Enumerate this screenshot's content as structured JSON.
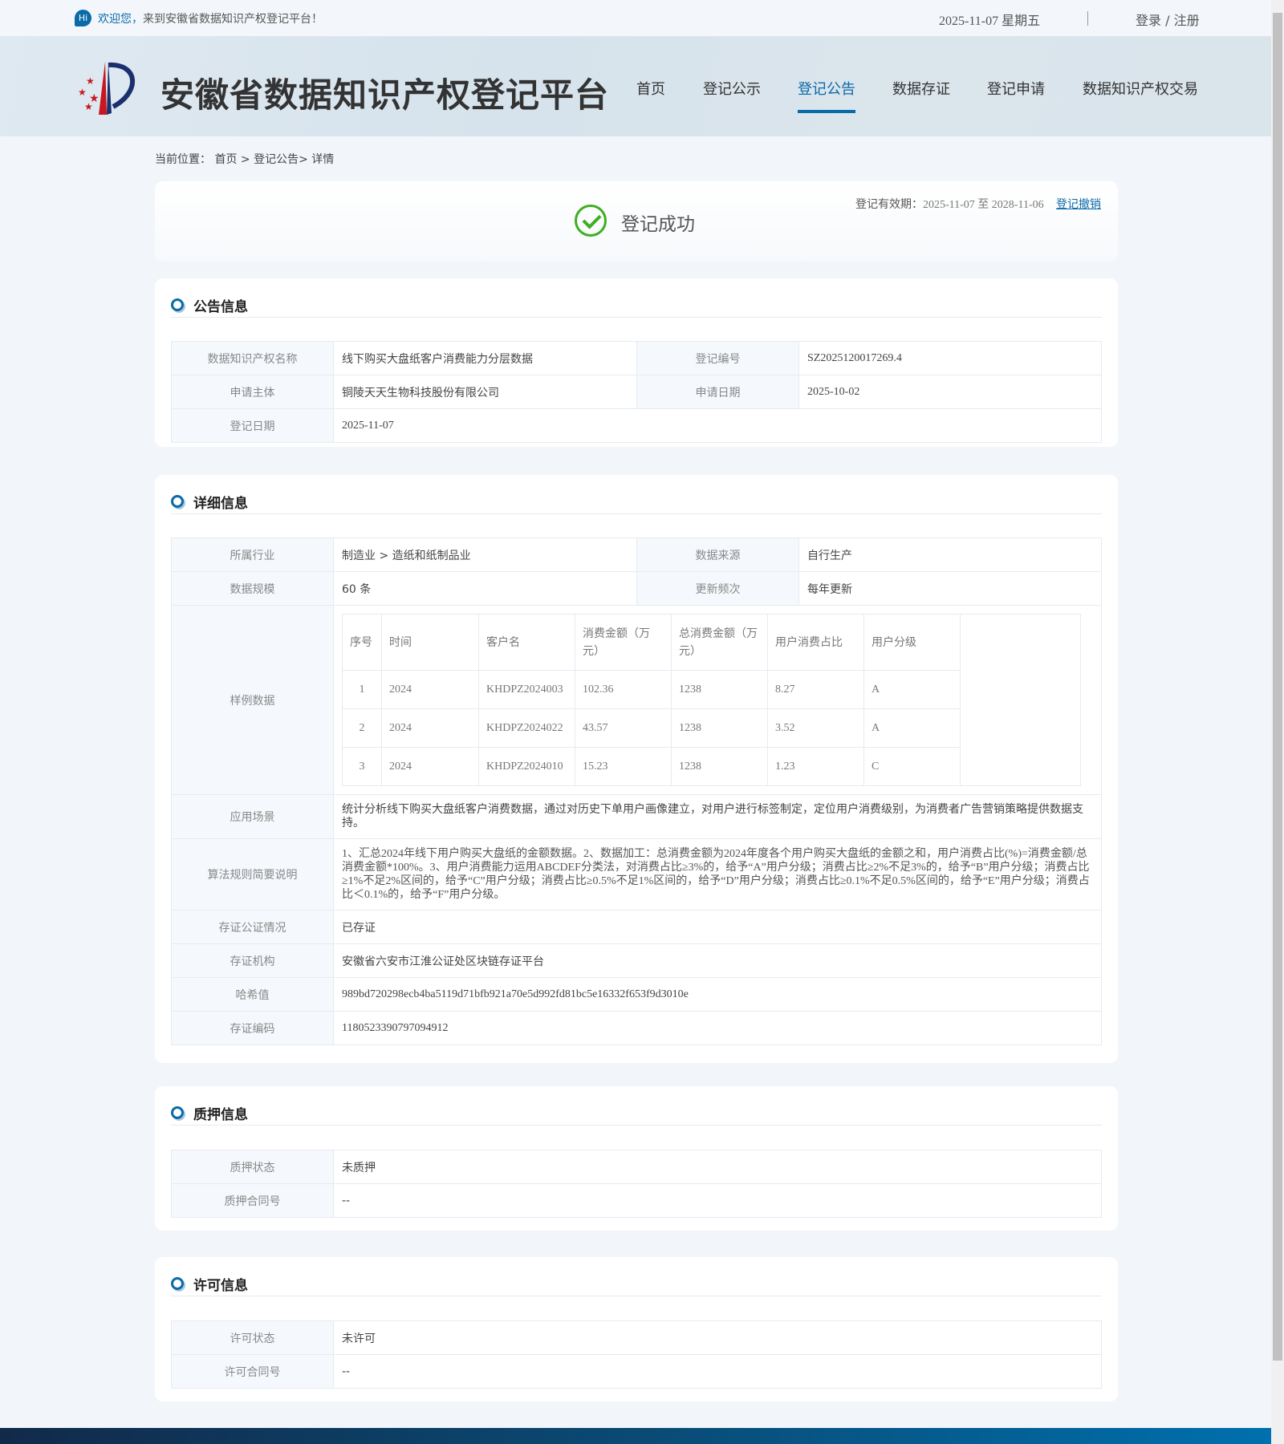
{
  "topbar": {
    "hi": "Hi",
    "welcome_blue": "欢迎您，",
    "welcome_rest": "来到安徽省数据知识产权登记平台！",
    "date": "2025-11-07 星期五",
    "login": "登录 / 注册"
  },
  "header": {
    "site_title": "安徽省数据知识产权登记平台",
    "nav": [
      "首页",
      "登记公示",
      "登记公告",
      "数据存证",
      "登记申请",
      "数据知识产权交易"
    ],
    "active_index": 2
  },
  "breadcrumb": "当前位置： 首页 > 登记公告> 详情",
  "status": {
    "title": "登记成功",
    "validity_label": "登记有效期：",
    "validity_range": "2025-11-07 至 2028-11-06",
    "revoke": "登记撤销",
    "color": "#3daf1f"
  },
  "announcement": {
    "title": "公告信息",
    "name_label": "数据知识产权名称",
    "name": "线下购买大盘纸客户消费能力分层数据",
    "reg_no_label": "登记编号",
    "reg_no": "SZ2025120017269.4",
    "applicant_label": "申请主体",
    "applicant": "铜陵天天生物科技股份有限公司",
    "apply_date_label": "申请日期",
    "apply_date": "2025-10-02",
    "reg_date_label": "登记日期",
    "reg_date": "2025-11-07"
  },
  "detail": {
    "title": "详细信息",
    "industry_label": "所属行业",
    "industry": "制造业 > 造纸和纸制品业",
    "source_label": "数据来源",
    "source": "自行生产",
    "scale_label": "数据规模",
    "scale": "60 条",
    "freq_label": "更新频次",
    "freq": "每年更新",
    "sample_label": "样例数据",
    "sample": {
      "headers": [
        "序号",
        "时间",
        "客户名",
        "消费金额（万元）",
        "总消费金额（万元）",
        "用户消费占比",
        "用户分级"
      ],
      "rows": [
        [
          "1",
          "2024",
          "KHDPZ2024003",
          "102.36",
          "1238",
          "8.27",
          "A"
        ],
        [
          "2",
          "2024",
          "KHDPZ2024022",
          "43.57",
          "1238",
          "3.52",
          "A"
        ],
        [
          "3",
          "2024",
          "KHDPZ2024010",
          "15.23",
          "1238",
          "1.23",
          "C"
        ]
      ]
    },
    "scenario_label": "应用场景",
    "scenario": "统计分析线下购买大盘纸客户消费数据，通过对历史下单用户画像建立，对用户进行标签制定，定位用户消费级别，为消费者广告营销策略提供数据支持。",
    "algo_label": "算法规则简要说明",
    "algo": "1、汇总2024年线下用户购买大盘纸的金额数据。2、数据加工：总消费金额为2024年度各个用户购买大盘纸的金额之和，用户消费占比(%)=消费金额/总消费金额*100%。3、用户消费能力运用ABCDEF分类法，对消费占比≥3%的，给予“A”用户分级；消费占比≥2%不足3%的，给予“B”用户分级；消费占比≥1%不足2%区间的，给予“C”用户分级；消费占比≥0.5%不足1%区间的，给予“D”用户分级；消费占比≥0.1%不足0.5%区间的，给予“E”用户分级；消费占比＜0.1%的，给予“F”用户分级。",
    "notary_label": "存证公证情况",
    "notary": "已存证",
    "org_label": "存证机构",
    "org": "安徽省六安市江淮公证处区块链存证平台",
    "hash_label": "哈希值",
    "hash": "989bd720298ecb4ba5119d71bfb921a70e5d992fd81bc5e16332f653f9d3010e",
    "code_label": "存证编码",
    "code": "1180523390797094912"
  },
  "pledge": {
    "title": "质押信息",
    "status_label": "质押状态",
    "status": "未质押",
    "contract_label": "质押合同号",
    "contract": "--"
  },
  "license": {
    "title": "许可信息",
    "status_label": "许可状态",
    "status": "未许可",
    "contract_label": "许可合同号",
    "contract": "--"
  }
}
